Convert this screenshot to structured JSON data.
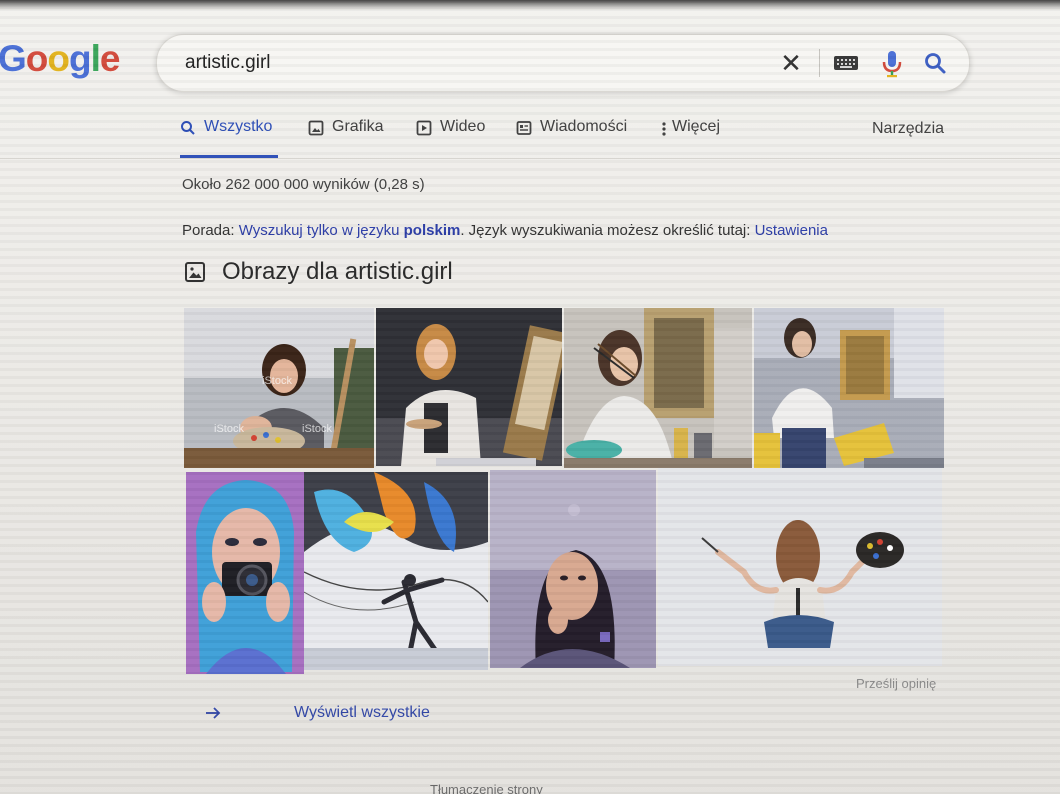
{
  "logo": {
    "text": "Google",
    "letters": [
      "G",
      "o",
      "o",
      "g",
      "l",
      "e"
    ]
  },
  "search": {
    "query": "artistic.girl",
    "clear_icon": "close-icon",
    "keyboard_icon": "keyboard-icon",
    "mic_icon": "mic-icon",
    "submit_icon": "search-icon"
  },
  "tabs": [
    {
      "label": "Wszystko",
      "icon": "search-icon",
      "active": true
    },
    {
      "label": "Grafika",
      "icon": "image-icon",
      "active": false
    },
    {
      "label": "Wideo",
      "icon": "video-icon",
      "active": false
    },
    {
      "label": "Wiadomości",
      "icon": "news-icon",
      "active": false
    },
    {
      "label": "Więcej",
      "icon": "more-vert-icon",
      "active": false
    }
  ],
  "tools_label": "Narzędzia",
  "result_stats": "Około 262 000 000 wyników (0,28 s)",
  "tip": {
    "prefix": "Porada:",
    "link_text": "Wyszukuj tylko w języku",
    "link_bold": "polskim",
    "middle": ". Język wyszukiwania możesz określić tutaj:",
    "settings_link": "Ustawienia"
  },
  "images_section": {
    "title": "Obrazy dla artistic.girl",
    "icon": "image-icon",
    "thumbnails": [
      {
        "name": "girl-with-palette-on-easel",
        "watermark": "iStock"
      },
      {
        "name": "girl-painting-at-easel"
      },
      {
        "name": "woman-holding-brushes-thinking"
      },
      {
        "name": "woman-in-studio-with-paint"
      },
      {
        "name": "girl-blue-hair-with-camera"
      },
      {
        "name": "abstract-dancer-painting"
      },
      {
        "name": "girl-portrait-looking-up"
      },
      {
        "name": "girl-back-view-palette"
      }
    ],
    "view_all_label": "Wyświetl wszystkie",
    "feedback_label": "Prześlij opinię"
  },
  "footer_text": "Tłumaczenie strony",
  "colors": {
    "link": "#2d3ea8",
    "tab_active": "#2d4fb8",
    "mic_red": "#d24a3c",
    "mic_blue": "#4a6fd6"
  }
}
